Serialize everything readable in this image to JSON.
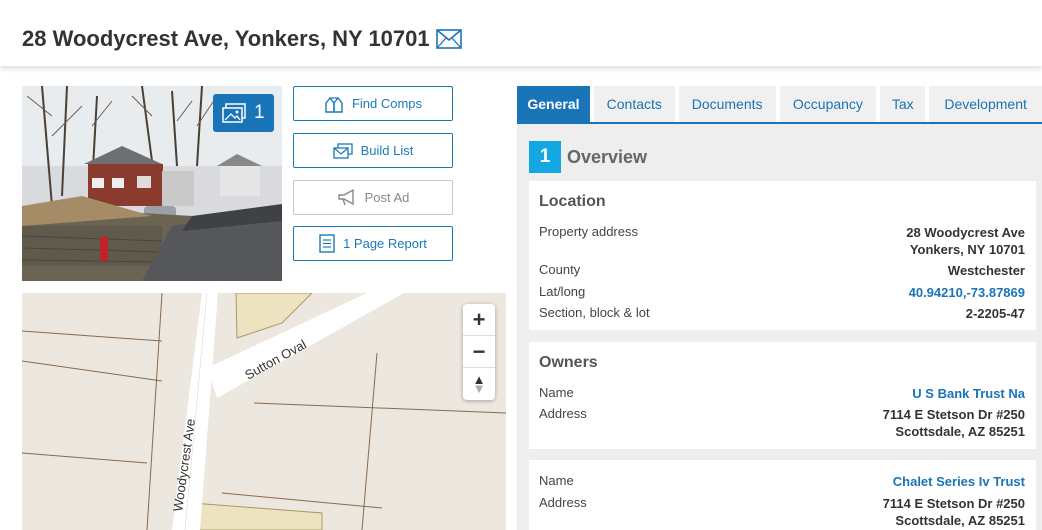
{
  "header": {
    "title": "28 Woodycrest Ave, Yonkers, NY 10701",
    "email_icon": "envelope-icon",
    "print_icon": "printer-icon",
    "highlight_color": "#e5141d"
  },
  "photo": {
    "count": "1"
  },
  "actions": {
    "find_comps": "Find Comps",
    "build_list": "Build List",
    "post_ad": "Post Ad",
    "page_report": "1 Page Report"
  },
  "map": {
    "street_1": "Sutton Oval",
    "street_2": "Woodycrest Ave",
    "zoom_in": "+",
    "zoom_out": "−",
    "compass_up": "▲",
    "compass_down": "▼"
  },
  "tabs": [
    {
      "label": "General",
      "active": true
    },
    {
      "label": "Contacts",
      "active": false
    },
    {
      "label": "Documents",
      "active": false
    },
    {
      "label": "Occupancy",
      "active": false
    },
    {
      "label": "Tax",
      "active": false
    },
    {
      "label": "Development",
      "active": false
    }
  ],
  "overview": {
    "number": "1",
    "title": "Overview"
  },
  "location": {
    "title": "Location",
    "property_address_label": "Property address",
    "property_address_line1": "28 Woodycrest Ave",
    "property_address_line2": "Yonkers, NY 10701",
    "county_label": "County",
    "county_value": "Westchester",
    "latlong_label": "Lat/long",
    "latlong_value": "40.94210,-73.87869",
    "sbl_label": "Section, block & lot",
    "sbl_value": "2-2205-47"
  },
  "owners": {
    "title": "Owners",
    "entries": [
      {
        "name_label": "Name",
        "name_value": "U S Bank Trust Na",
        "address_label": "Address",
        "address_line1": "7114 E Stetson Dr #250",
        "address_line2": "Scottsdale, AZ 85251"
      },
      {
        "name_label": "Name",
        "name_value": "Chalet Series Iv Trust",
        "address_label": "Address",
        "address_line1": "7114 E Stetson Dr #250",
        "address_line2": "Scottsdale, AZ 85251"
      }
    ]
  },
  "colors": {
    "accent": "#1a74b8",
    "overview_badge": "#13a8e3",
    "panel_bg": "#eeeeee"
  }
}
